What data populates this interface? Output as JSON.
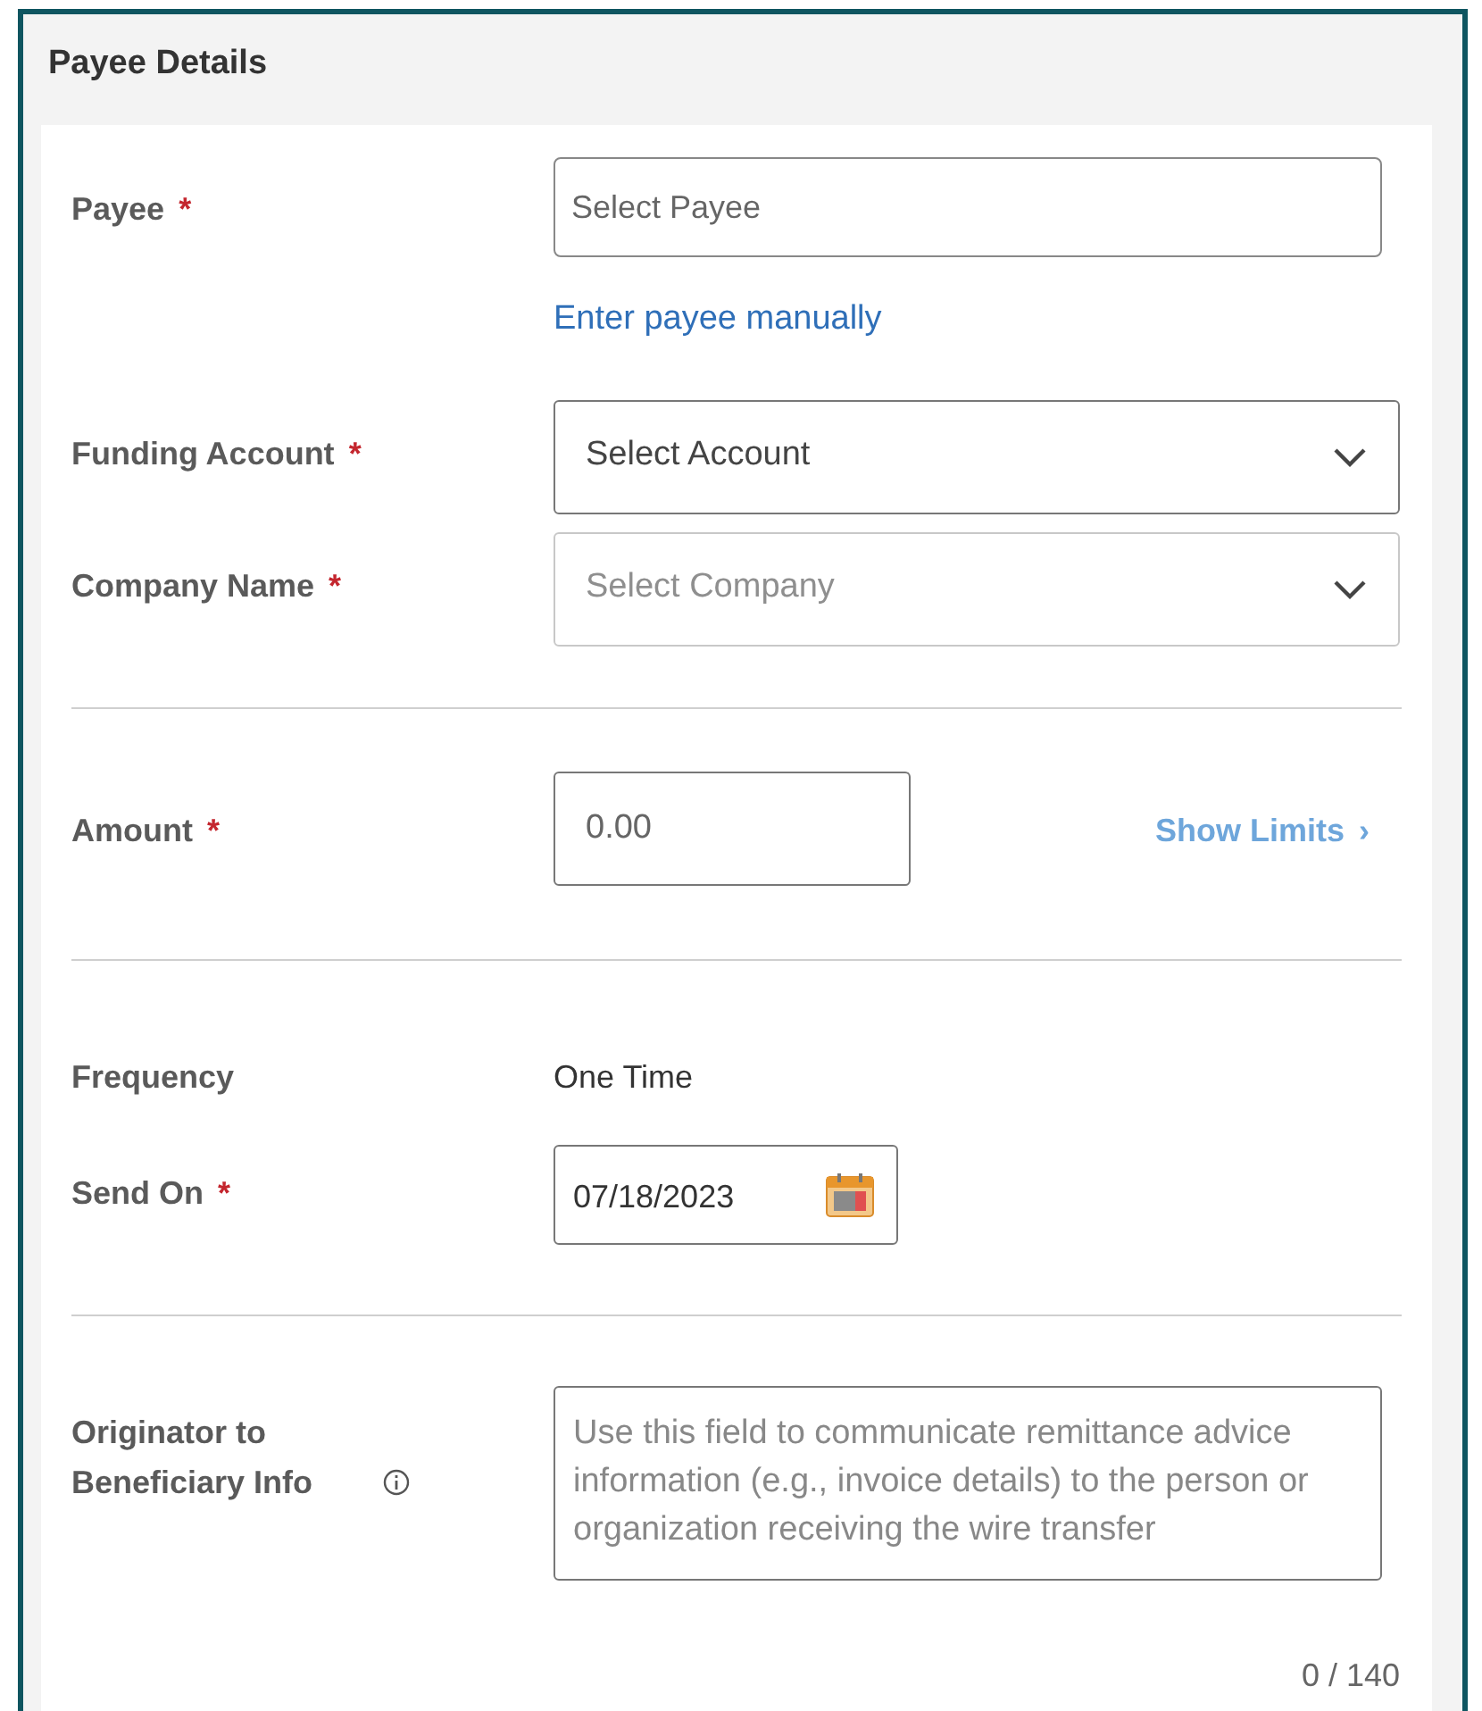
{
  "panel": {
    "title": "Payee Details"
  },
  "sections": [
    {
      "fields": [
        {
          "kind": "input",
          "label": "Payee",
          "required_mark": "*",
          "placeholder": "Select Payee",
          "link": "Enter payee manually"
        },
        {
          "kind": "select",
          "label": "Funding Account",
          "required_mark": "*",
          "placeholder": "Select Account",
          "disabled": false
        },
        {
          "kind": "select",
          "label": "Company Name",
          "required_mark": "*",
          "placeholder": "Select Company",
          "disabled": true
        }
      ]
    },
    {
      "fields": [
        {
          "kind": "amount",
          "label": "Amount",
          "required_mark": "*",
          "placeholder": "0.00",
          "link": "Show Limits",
          "link_chevron": "›"
        }
      ]
    },
    {
      "fields": [
        {
          "kind": "static",
          "label": "Frequency",
          "value": "One Time"
        },
        {
          "kind": "date",
          "label": "Send On",
          "required_mark": "*",
          "value": "07/18/2023"
        }
      ]
    },
    {
      "fields": [
        {
          "kind": "textarea",
          "label": "Originator to Beneficiary Info",
          "info": true,
          "placeholder": "Use this field to communicate remittance advice information (e.g., invoice details) to the person or organization receiving the wire transfer",
          "counter": "0 / 140"
        }
      ]
    }
  ]
}
